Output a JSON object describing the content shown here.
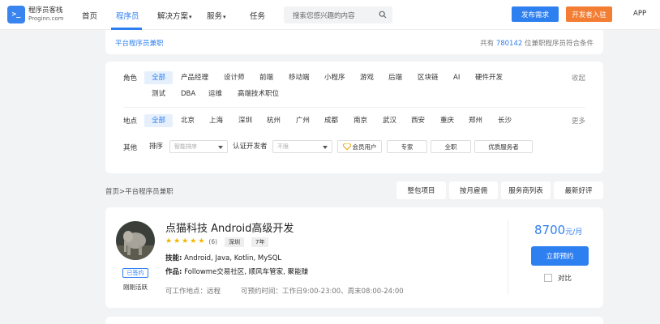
{
  "header": {
    "logo": {
      "cn": "程序员客栈",
      "en": "Proginn.com",
      "mark": ">_"
    },
    "nav": [
      "首页",
      "程序员",
      "解决方案",
      "服务",
      "任务"
    ],
    "search_placeholder": "搜索您感兴趣的内容",
    "publish_label": "发布需求",
    "join_label": "开发者入驻",
    "app_label": "APP",
    "accent": "#2e7ff0",
    "join_color": "#f27d33"
  },
  "titlebar": {
    "title": "平台程序员兼职",
    "total_prefix": "共有",
    "total_count": "780142",
    "total_suffix": "位兼职程序员符合条件"
  },
  "filters": {
    "role_label": "角色",
    "roles_row1": [
      "全部",
      "产品经理",
      "设计师",
      "前端",
      "移动端",
      "小程序",
      "游戏",
      "后端",
      "区块链",
      "AI",
      "硬件开发"
    ],
    "roles_row2": [
      "测试",
      "DBA",
      "运维",
      "高端技术职位"
    ],
    "collapse_label": "收起",
    "location_label": "地点",
    "locations": [
      "全部",
      "北京",
      "上海",
      "深圳",
      "杭州",
      "广州",
      "成都",
      "南京",
      "武汉",
      "西安",
      "重庆",
      "郑州",
      "长沙"
    ],
    "more_label": "更多",
    "other_label": "其他",
    "sort_label": "排序",
    "sort_placeholder": "智能排序",
    "cert_label": "认证开发者",
    "cert_placeholder": "不限",
    "member_label": "会员用户",
    "expert_label": "专家",
    "fulltime_label": "全职",
    "premium_label": "优质服务者"
  },
  "breadcrumb": "首页>平台程序员兼职",
  "sort_tabs": [
    "整包项目",
    "按月雇佣",
    "服务商列表",
    "最新好评"
  ],
  "card": {
    "name": "点猫科技 Android高级开发",
    "rating": 5,
    "rating_count": "(6)",
    "tag_city": "深圳",
    "tag_years": "7年",
    "skills_label": "技能:",
    "skills": "Android, Java, Kotlin, MySQL",
    "works_label": "作品:",
    "works": "Followme交易社区, 顺风车管家, 聚能赚",
    "location": "可工作地点：远程",
    "time": "可预约时间：工作日9:00-23:00、周末08:00-24:00",
    "signed_label": "已签约",
    "active_state": "刚刚活跃",
    "price_value": "8700",
    "price_unit": "元/月",
    "book_label": "立即预约",
    "compare_label": "对比"
  }
}
